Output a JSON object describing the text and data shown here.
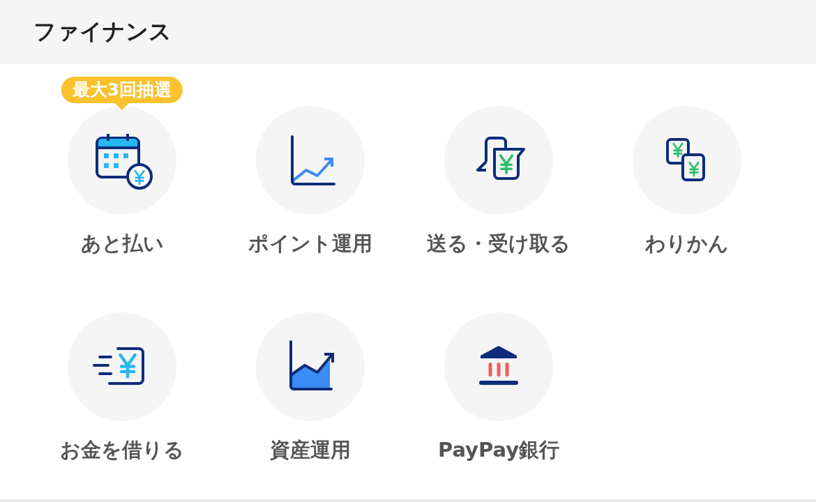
{
  "header": {
    "title": "ファイナンス"
  },
  "items": [
    {
      "label": "あと払い",
      "kind": "calendar",
      "badge": "最大3回抽選"
    },
    {
      "label": "ポイント運用",
      "kind": "line-chart"
    },
    {
      "label": "送る・受け取る",
      "kind": "speech"
    },
    {
      "label": "わりかん",
      "kind": "split"
    },
    {
      "label": "お金を借りる",
      "kind": "borrow"
    },
    {
      "label": "資産運用",
      "kind": "area-chart"
    },
    {
      "label": "PayPay銀行",
      "kind": "bank"
    }
  ]
}
